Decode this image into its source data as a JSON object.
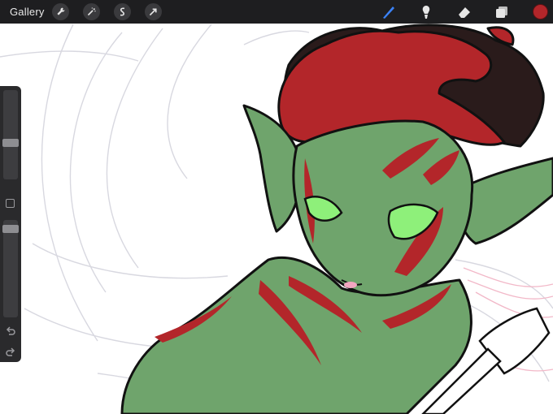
{
  "topbar": {
    "gallery_label": "Gallery",
    "left_tools": [
      "wrench-icon",
      "magic-wand-icon",
      "selection-icon",
      "transform-arrow-icon"
    ],
    "right_tools": [
      "brush-icon",
      "smudge-icon",
      "eraser-icon",
      "layers-icon"
    ],
    "active_tool": "brush-icon",
    "current_color": "#b3262a"
  },
  "sidebar": {
    "brush_size_level": 0.4,
    "opacity_level": 0.95,
    "buttons": [
      "modify-button",
      "undo-icon",
      "redo-icon"
    ]
  },
  "colors": {
    "skin": "#6fa46c",
    "hair_red": "#b3262a",
    "hair_dark": "#2a1b1b",
    "eyes": "#8ef07a",
    "accent_blue": "#3b82f6"
  }
}
